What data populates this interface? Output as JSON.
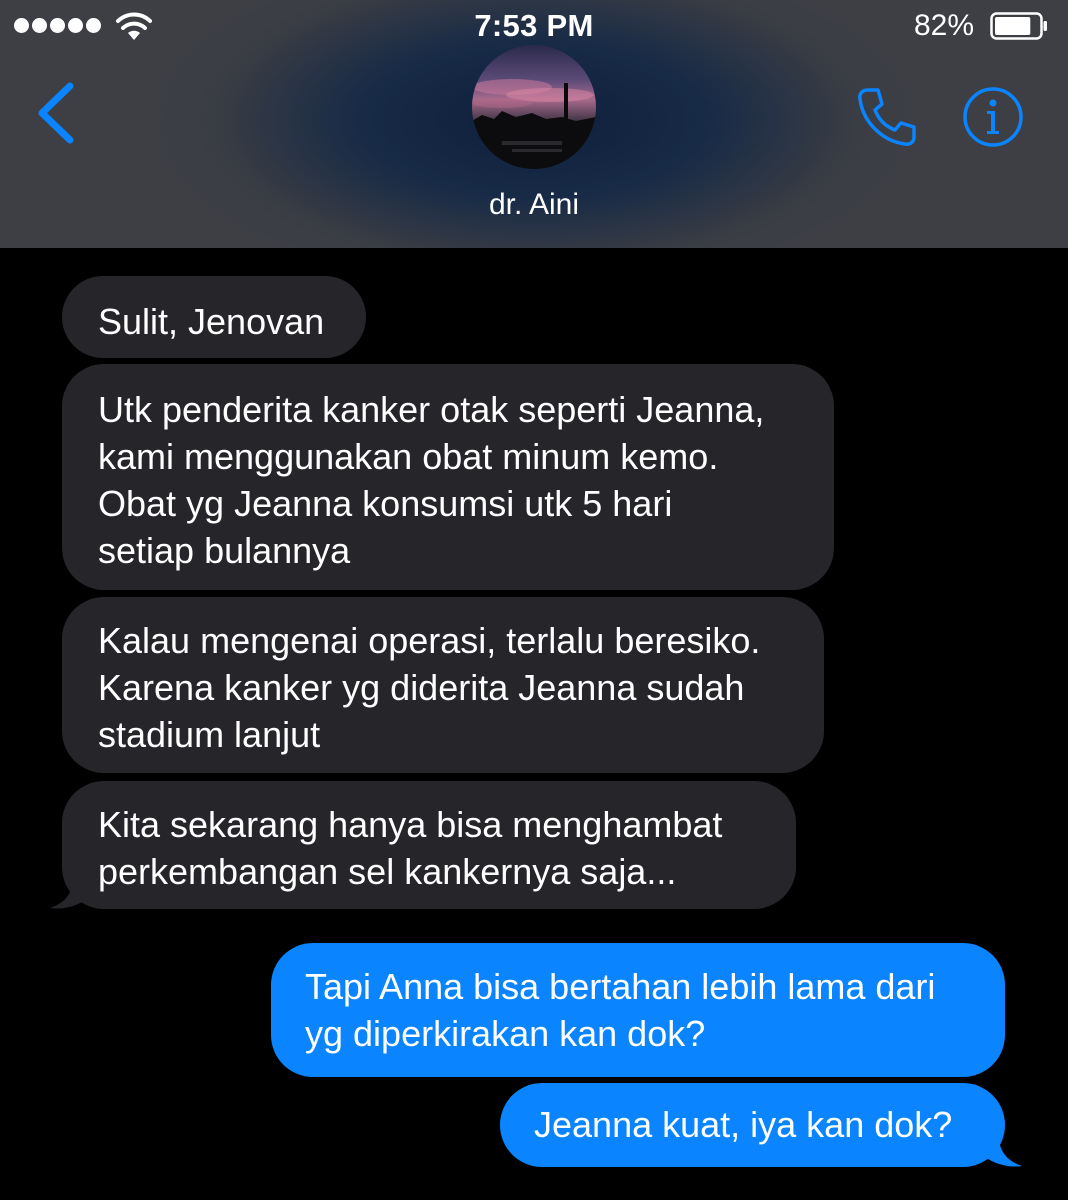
{
  "status_bar": {
    "time": "7:53 PM",
    "battery_percent": "82%",
    "battery_level": 0.82,
    "signal_bars": 5
  },
  "header": {
    "contact_name": "dr. Aini",
    "back_icon": "chevron-left-icon",
    "call_icon": "phone-icon",
    "info_icon": "info-icon"
  },
  "messages": [
    {
      "direction": "incoming",
      "text": "Sulit, Jenovan"
    },
    {
      "direction": "incoming",
      "text": "Utk penderita kanker otak seperti Jeanna,\nkami menggunakan obat minum kemo.\nObat yg Jeanna konsumsi utk 5 hari\nsetiap bulannya"
    },
    {
      "direction": "incoming",
      "text": "Kalau mengenai operasi, terlalu beresiko.\nKarena kanker yg diderita Jeanna sudah\nstadium lanjut"
    },
    {
      "direction": "incoming",
      "text": "Kita sekarang hanya bisa menghambat\nperkembangan sel kankernya saja..."
    },
    {
      "direction": "outgoing",
      "text": "Tapi Anna bisa bertahan lebih lama dari\nyg diperkirakan kan dok?"
    },
    {
      "direction": "outgoing",
      "text": "Jeanna kuat, iya kan dok?"
    }
  ],
  "colors": {
    "accent": "#0a84ff",
    "incoming_bubble": "#26252a",
    "outgoing_bubble": "#0a84ff",
    "background": "#000000"
  }
}
